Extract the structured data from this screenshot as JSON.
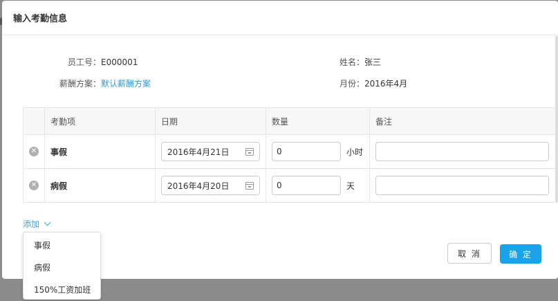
{
  "modal": {
    "title": "输入考勤信息"
  },
  "info": {
    "employee_id_label": "员工号：",
    "employee_id_value": "E000001",
    "name_label": "姓名：",
    "name_value": "张三",
    "salary_plan_label": "薪酬方案：",
    "salary_plan_value": "默认薪酬方案",
    "month_label": "月份：",
    "month_value": "2016年4月"
  },
  "table": {
    "headers": [
      "考勤项",
      "日期",
      "数量",
      "备注"
    ],
    "rows": [
      {
        "type": "事假",
        "date": "2016年4月21日",
        "quantity": "0",
        "unit": "小时",
        "remark": ""
      },
      {
        "type": "病假",
        "date": "2016年4月20日",
        "quantity": "0",
        "unit": "天",
        "remark": ""
      }
    ]
  },
  "add_label": "添加",
  "dropdown": {
    "items": [
      "事假",
      "病假",
      "150%工资加班"
    ]
  },
  "buttons": {
    "cancel": "取 消",
    "ok": "确 定"
  },
  "icons": {
    "remove": "remove-circle-icon",
    "calendar": "calendar-icon",
    "chevron": "chevron-down-icon"
  },
  "colors": {
    "accent": "#1aa3e8",
    "link": "#2d9ad8"
  }
}
